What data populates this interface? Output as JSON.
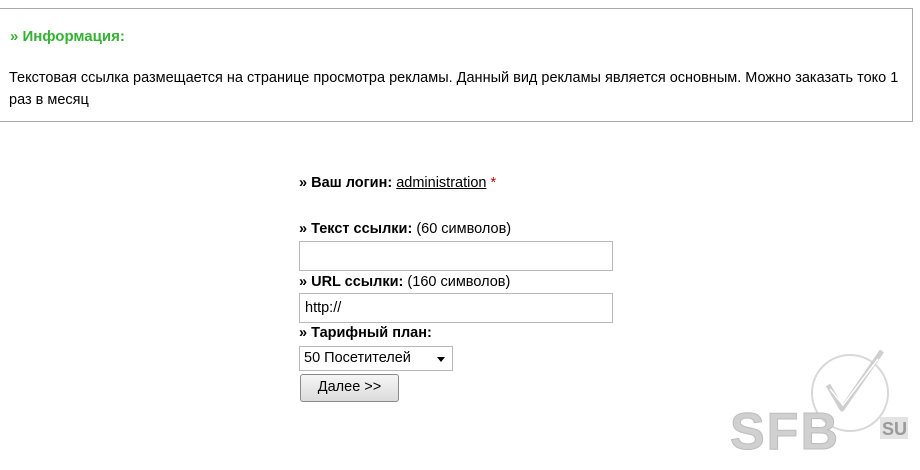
{
  "info": {
    "title": "» Информация:",
    "text": "Текстовая ссылка размещается на странице просмотра рекламы. Данный вид рекламы является основным. Можно заказать токо 1 раз в месяц"
  },
  "form": {
    "login_label": "» Ваш логин:",
    "login_value": "administration",
    "required_mark": "*",
    "link_text_label": "» Текст ссылки:",
    "link_text_hint": "(60 символов)",
    "link_text_value": "",
    "url_label": "» URL ссылки:",
    "url_hint": "(160 символов)",
    "url_value": "http://",
    "plan_label": "» Тарифный план:",
    "plan_selected": "50 Посетителей",
    "next_button": "Далее >>"
  },
  "watermark": {
    "logo_text": "SFB",
    "domain_text": "SU"
  }
}
